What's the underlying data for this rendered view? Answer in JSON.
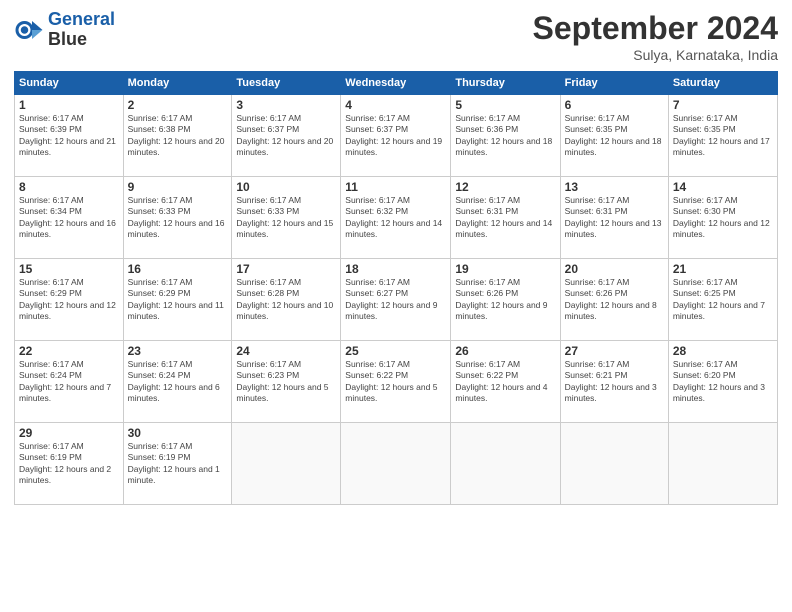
{
  "header": {
    "logo_line1": "General",
    "logo_line2": "Blue",
    "month_title": "September 2024",
    "subtitle": "Sulya, Karnataka, India"
  },
  "weekdays": [
    "Sunday",
    "Monday",
    "Tuesday",
    "Wednesday",
    "Thursday",
    "Friday",
    "Saturday"
  ],
  "weeks": [
    [
      {
        "day": "1",
        "sunrise": "Sunrise: 6:17 AM",
        "sunset": "Sunset: 6:39 PM",
        "daylight": "Daylight: 12 hours and 21 minutes."
      },
      {
        "day": "2",
        "sunrise": "Sunrise: 6:17 AM",
        "sunset": "Sunset: 6:38 PM",
        "daylight": "Daylight: 12 hours and 20 minutes."
      },
      {
        "day": "3",
        "sunrise": "Sunrise: 6:17 AM",
        "sunset": "Sunset: 6:37 PM",
        "daylight": "Daylight: 12 hours and 20 minutes."
      },
      {
        "day": "4",
        "sunrise": "Sunrise: 6:17 AM",
        "sunset": "Sunset: 6:37 PM",
        "daylight": "Daylight: 12 hours and 19 minutes."
      },
      {
        "day": "5",
        "sunrise": "Sunrise: 6:17 AM",
        "sunset": "Sunset: 6:36 PM",
        "daylight": "Daylight: 12 hours and 18 minutes."
      },
      {
        "day": "6",
        "sunrise": "Sunrise: 6:17 AM",
        "sunset": "Sunset: 6:35 PM",
        "daylight": "Daylight: 12 hours and 18 minutes."
      },
      {
        "day": "7",
        "sunrise": "Sunrise: 6:17 AM",
        "sunset": "Sunset: 6:35 PM",
        "daylight": "Daylight: 12 hours and 17 minutes."
      }
    ],
    [
      {
        "day": "8",
        "sunrise": "Sunrise: 6:17 AM",
        "sunset": "Sunset: 6:34 PM",
        "daylight": "Daylight: 12 hours and 16 minutes."
      },
      {
        "day": "9",
        "sunrise": "Sunrise: 6:17 AM",
        "sunset": "Sunset: 6:33 PM",
        "daylight": "Daylight: 12 hours and 16 minutes."
      },
      {
        "day": "10",
        "sunrise": "Sunrise: 6:17 AM",
        "sunset": "Sunset: 6:33 PM",
        "daylight": "Daylight: 12 hours and 15 minutes."
      },
      {
        "day": "11",
        "sunrise": "Sunrise: 6:17 AM",
        "sunset": "Sunset: 6:32 PM",
        "daylight": "Daylight: 12 hours and 14 minutes."
      },
      {
        "day": "12",
        "sunrise": "Sunrise: 6:17 AM",
        "sunset": "Sunset: 6:31 PM",
        "daylight": "Daylight: 12 hours and 14 minutes."
      },
      {
        "day": "13",
        "sunrise": "Sunrise: 6:17 AM",
        "sunset": "Sunset: 6:31 PM",
        "daylight": "Daylight: 12 hours and 13 minutes."
      },
      {
        "day": "14",
        "sunrise": "Sunrise: 6:17 AM",
        "sunset": "Sunset: 6:30 PM",
        "daylight": "Daylight: 12 hours and 12 minutes."
      }
    ],
    [
      {
        "day": "15",
        "sunrise": "Sunrise: 6:17 AM",
        "sunset": "Sunset: 6:29 PM",
        "daylight": "Daylight: 12 hours and 12 minutes."
      },
      {
        "day": "16",
        "sunrise": "Sunrise: 6:17 AM",
        "sunset": "Sunset: 6:29 PM",
        "daylight": "Daylight: 12 hours and 11 minutes."
      },
      {
        "day": "17",
        "sunrise": "Sunrise: 6:17 AM",
        "sunset": "Sunset: 6:28 PM",
        "daylight": "Daylight: 12 hours and 10 minutes."
      },
      {
        "day": "18",
        "sunrise": "Sunrise: 6:17 AM",
        "sunset": "Sunset: 6:27 PM",
        "daylight": "Daylight: 12 hours and 9 minutes."
      },
      {
        "day": "19",
        "sunrise": "Sunrise: 6:17 AM",
        "sunset": "Sunset: 6:26 PM",
        "daylight": "Daylight: 12 hours and 9 minutes."
      },
      {
        "day": "20",
        "sunrise": "Sunrise: 6:17 AM",
        "sunset": "Sunset: 6:26 PM",
        "daylight": "Daylight: 12 hours and 8 minutes."
      },
      {
        "day": "21",
        "sunrise": "Sunrise: 6:17 AM",
        "sunset": "Sunset: 6:25 PM",
        "daylight": "Daylight: 12 hours and 7 minutes."
      }
    ],
    [
      {
        "day": "22",
        "sunrise": "Sunrise: 6:17 AM",
        "sunset": "Sunset: 6:24 PM",
        "daylight": "Daylight: 12 hours and 7 minutes."
      },
      {
        "day": "23",
        "sunrise": "Sunrise: 6:17 AM",
        "sunset": "Sunset: 6:24 PM",
        "daylight": "Daylight: 12 hours and 6 minutes."
      },
      {
        "day": "24",
        "sunrise": "Sunrise: 6:17 AM",
        "sunset": "Sunset: 6:23 PM",
        "daylight": "Daylight: 12 hours and 5 minutes."
      },
      {
        "day": "25",
        "sunrise": "Sunrise: 6:17 AM",
        "sunset": "Sunset: 6:22 PM",
        "daylight": "Daylight: 12 hours and 5 minutes."
      },
      {
        "day": "26",
        "sunrise": "Sunrise: 6:17 AM",
        "sunset": "Sunset: 6:22 PM",
        "daylight": "Daylight: 12 hours and 4 minutes."
      },
      {
        "day": "27",
        "sunrise": "Sunrise: 6:17 AM",
        "sunset": "Sunset: 6:21 PM",
        "daylight": "Daylight: 12 hours and 3 minutes."
      },
      {
        "day": "28",
        "sunrise": "Sunrise: 6:17 AM",
        "sunset": "Sunset: 6:20 PM",
        "daylight": "Daylight: 12 hours and 3 minutes."
      }
    ],
    [
      {
        "day": "29",
        "sunrise": "Sunrise: 6:17 AM",
        "sunset": "Sunset: 6:19 PM",
        "daylight": "Daylight: 12 hours and 2 minutes."
      },
      {
        "day": "30",
        "sunrise": "Sunrise: 6:17 AM",
        "sunset": "Sunset: 6:19 PM",
        "daylight": "Daylight: 12 hours and 1 minute."
      },
      null,
      null,
      null,
      null,
      null
    ]
  ]
}
